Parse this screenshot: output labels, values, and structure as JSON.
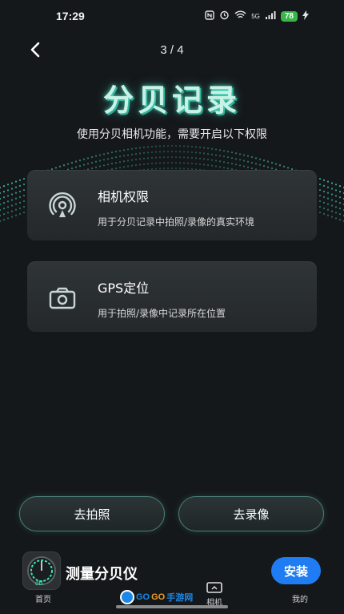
{
  "status_bar": {
    "time": "17:29",
    "signal_text": "5G",
    "battery_level": "78"
  },
  "header": {
    "page_indicator": "3 / 4"
  },
  "hero": {
    "title": "分贝记录",
    "subtitle": "使用分贝相机功能，需要开启以下权限"
  },
  "permissions": [
    {
      "title": "相机权限",
      "description": "用于分贝记录中拍照/录像的真实环境",
      "icon": "camera-signal-icon"
    },
    {
      "title": "GPS定位",
      "description": "用于拍照/录像中记录所在位置",
      "icon": "camera-icon"
    }
  ],
  "actions": {
    "photo_label": "去拍照",
    "record_label": "去录像"
  },
  "app_bar": {
    "app_name": "测量分贝仪",
    "install_label": "安装",
    "logo_text": "dB",
    "tabs": {
      "home": "首页",
      "camera": "相机",
      "mine": "我的"
    }
  },
  "watermark": {
    "go1": "GO",
    "go2": "GO",
    "site": "手游网"
  },
  "colors": {
    "background": "#15181b",
    "accent": "#4b7f78",
    "title_glow": "#c9f2e6",
    "install": "#1f7cf2"
  }
}
